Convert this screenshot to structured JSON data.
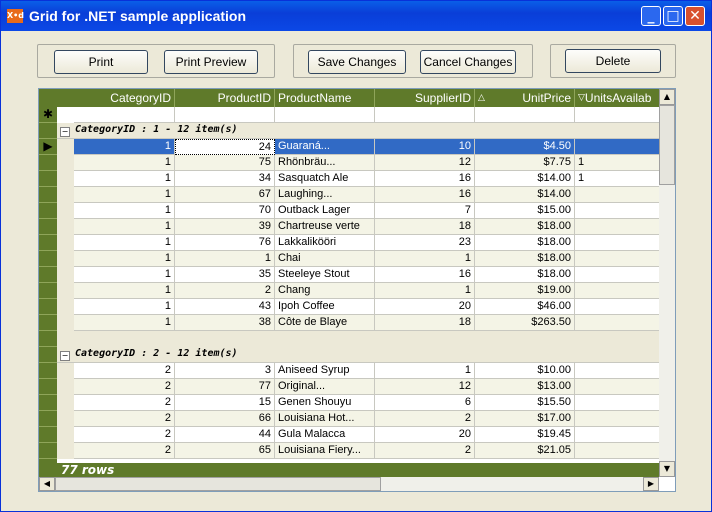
{
  "window": {
    "title": "Grid for .NET sample application",
    "icon": "app-icon"
  },
  "toolbar": {
    "print": "Print",
    "print_preview": "Print Preview",
    "save_changes": "Save Changes",
    "cancel_changes": "Cancel Changes",
    "delete": "Delete"
  },
  "grid": {
    "columns": [
      {
        "label": "CategoryID"
      },
      {
        "label": "ProductID"
      },
      {
        "label": "ProductName"
      },
      {
        "label": "SupplierID"
      },
      {
        "label": "UnitPrice",
        "sort": "ascending"
      },
      {
        "label": "UnitsAvailab",
        "sort": "descending"
      }
    ],
    "groups": [
      {
        "label": "CategoryID : 1 - 12 item(s)",
        "rows": [
          [
            "1",
            "24",
            "Guaraná...",
            "10",
            "$4.50",
            ""
          ],
          [
            "1",
            "75",
            "Rhönbräu...",
            "12",
            "$7.75",
            "1"
          ],
          [
            "1",
            "34",
            "Sasquatch Ale",
            "16",
            "$14.00",
            "1"
          ],
          [
            "1",
            "67",
            "Laughing...",
            "16",
            "$14.00",
            ""
          ],
          [
            "1",
            "70",
            "Outback Lager",
            "7",
            "$15.00",
            ""
          ],
          [
            "1",
            "39",
            "Chartreuse verte",
            "18",
            "$18.00",
            ""
          ],
          [
            "1",
            "76",
            "Lakkalikööri",
            "23",
            "$18.00",
            ""
          ],
          [
            "1",
            "1",
            "Chai",
            "1",
            "$18.00",
            ""
          ],
          [
            "1",
            "35",
            "Steeleye Stout",
            "16",
            "$18.00",
            ""
          ],
          [
            "1",
            "2",
            "Chang",
            "1",
            "$19.00",
            ""
          ],
          [
            "1",
            "43",
            "Ipoh Coffee",
            "20",
            "$46.00",
            ""
          ],
          [
            "1",
            "38",
            "Côte de Blaye",
            "18",
            "$263.50",
            ""
          ]
        ]
      },
      {
        "label": "CategoryID : 2 - 12 item(s)",
        "rows": [
          [
            "2",
            "3",
            "Aniseed Syrup",
            "1",
            "$10.00",
            ""
          ],
          [
            "2",
            "77",
            "Original...",
            "12",
            "$13.00",
            ""
          ],
          [
            "2",
            "15",
            "Genen Shouyu",
            "6",
            "$15.50",
            ""
          ],
          [
            "2",
            "66",
            "Louisiana Hot...",
            "2",
            "$17.00",
            ""
          ],
          [
            "2",
            "44",
            "Gula Malacca",
            "20",
            "$19.45",
            ""
          ],
          [
            "2",
            "65",
            "Louisiana Fiery...",
            "2",
            "$21.05",
            ""
          ]
        ]
      }
    ],
    "footer": "77 rows",
    "selected_row": 0,
    "colors": {
      "header": "#5f7a2a",
      "selection": "#316ac5"
    }
  }
}
